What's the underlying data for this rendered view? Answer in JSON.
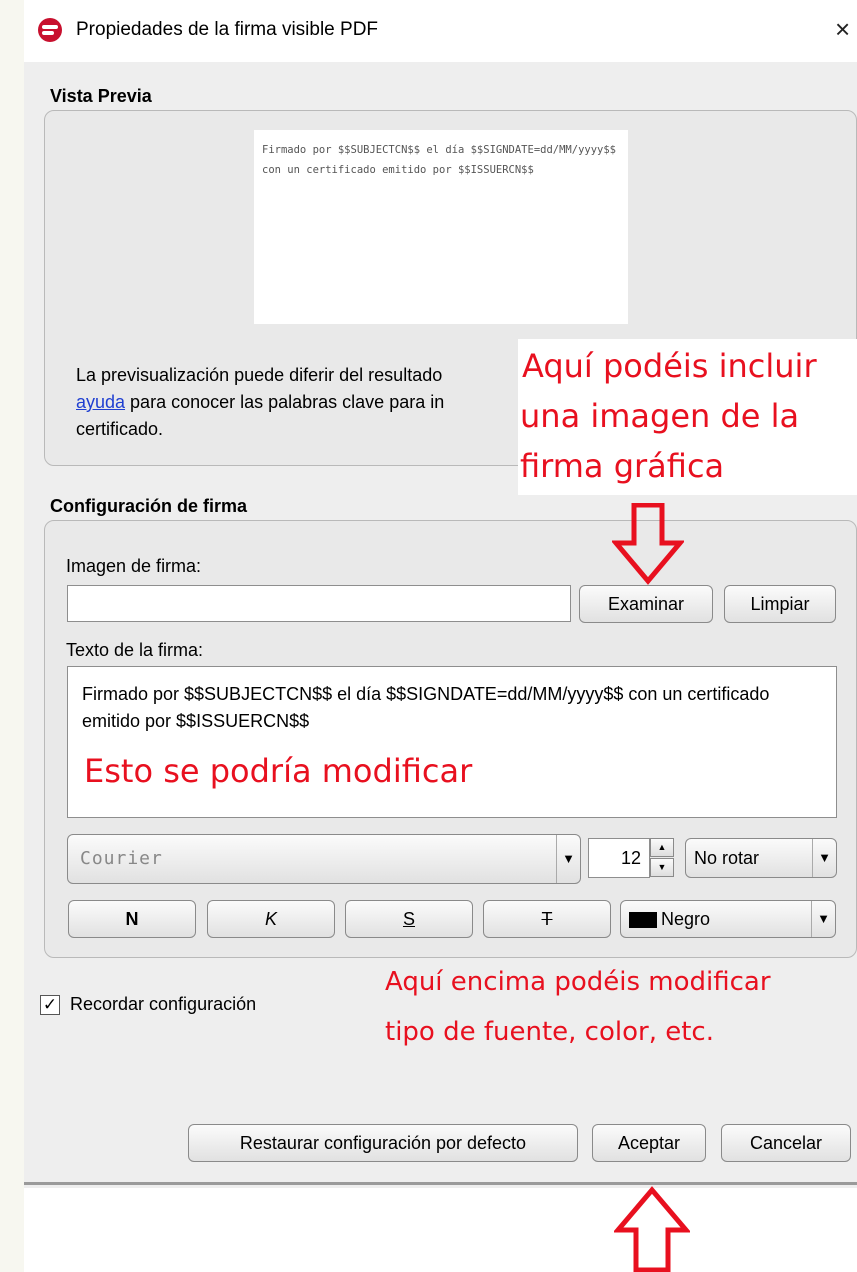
{
  "window": {
    "title": "Propiedades de la firma visible PDF",
    "close_glyph": "×"
  },
  "preview": {
    "section_label": "Vista Previa",
    "sample_text": "Firmado por $$SUBJECTCN$$ el día $$SIGNDATE=dd/MM/yyyy$$ con un certificado emitido por $$ISSUERCN$$",
    "info_line1": "La previsualización puede diferir del resultado",
    "info_link": "ayuda",
    "info_line2_rest": " para conocer las palabras clave para in",
    "info_line3": "certificado."
  },
  "config": {
    "section_label": "Configuración de firma",
    "image_label": "Imagen de firma:",
    "image_value": "",
    "browse_button": "Examinar",
    "clear_button": "Limpiar",
    "text_label": "Texto de la firma:",
    "text_value": "Firmado por $$SUBJECTCN$$ el día $$SIGNDATE=dd/MM/yyyy$$ con un certificado emitido por $$ISSUERCN$$",
    "font_value": "Courier",
    "size_value": "12",
    "rotation_value": "No rotar",
    "bold_label": "N",
    "italic_label": "K",
    "underline_label": "S",
    "strike_label": "T",
    "color_value": "Negro",
    "color_swatch": "#000000"
  },
  "remember": {
    "label": "Recordar configuración",
    "checked": true
  },
  "footer": {
    "restore_button": "Restaurar configuración por defecto",
    "accept_button": "Aceptar",
    "cancel_button": "Cancelar"
  },
  "annotations": {
    "image_note_1": "Aquí podéis incluir",
    "image_note_2": "una imagen de la",
    "image_note_3": "firma gráfica",
    "text_note": "Esto se podría modificar",
    "format_note_1": "Aquí encima podéis modificar",
    "format_note_2": "tipo de fuente, color, etc.",
    "accent_color": "#e8101f"
  }
}
